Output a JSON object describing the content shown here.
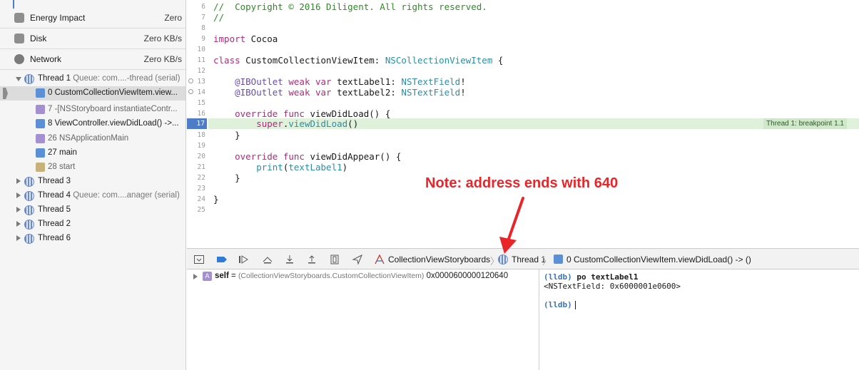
{
  "navigator": {
    "gauges": [
      {
        "label": "Energy Impact",
        "value": "Zero",
        "icon": "energy-icon"
      },
      {
        "label": "Disk",
        "value": "Zero KB/s",
        "icon": "disk-icon"
      },
      {
        "label": "Network",
        "value": "Zero KB/s",
        "icon": "network-icon"
      }
    ],
    "thread1": {
      "name": "Thread 1",
      "queue": "Queue: com....-thread (serial)"
    },
    "frames": [
      {
        "label": "0 CustomCollectionViewItem.view...",
        "kind": "user"
      },
      {
        "label": "7 -[NSStoryboard instantiateContr...",
        "kind": "framework"
      },
      {
        "label": "8 ViewController.viewDidLoad() ->...",
        "kind": "user"
      },
      {
        "label": "26 NSApplicationMain",
        "kind": "framework"
      },
      {
        "label": "27 main",
        "kind": "user"
      },
      {
        "label": "28 start",
        "kind": "system"
      }
    ],
    "threads": [
      {
        "name": "Thread 3",
        "queue": ""
      },
      {
        "name": "Thread 4",
        "queue": "Queue: com....anager (serial)"
      },
      {
        "name": "Thread 5",
        "queue": ""
      },
      {
        "name": "Thread 2",
        "queue": ""
      },
      {
        "name": "Thread 6",
        "queue": ""
      }
    ]
  },
  "editor": {
    "line_numbers": [
      "6",
      "7",
      "8",
      "9",
      "10",
      "11",
      "12",
      "13",
      "14",
      "15",
      "16",
      "17",
      "18",
      "19",
      "20",
      "21",
      "22",
      "23",
      "24",
      "25"
    ],
    "current_line": "17",
    "lines": {
      "l6": "//  Copyright © 2016 Diligent. All rights reserved.",
      "l7": "//",
      "l9_kw": "import",
      "l9_rest": " Cocoa",
      "l11_kw": "class",
      "l11_name": " CustomCollectionViewItem: ",
      "l11_type": "NSCollectionViewItem",
      "l11_end": " {",
      "l13_attr": "    @IBOutlet",
      "l13_kw": " weak var",
      "l13_name": " textLabel1: ",
      "l13_type": "NSTextField",
      "l13_end": "!",
      "l14_attr": "    @IBOutlet",
      "l14_kw": " weak var",
      "l14_name": " textLabel2: ",
      "l14_type": "NSTextField",
      "l14_end": "!",
      "l16_kw": "    override func",
      "l16_rest": " viewDidLoad() {",
      "l17_kw": "        super",
      "l17_dot": ".",
      "l17_call": "viewDidLoad",
      "l17_end": "()",
      "l18": "    }",
      "l20_kw": "    override func",
      "l20_rest": " viewDidAppear() {",
      "l21_call": "        print",
      "l21_paren": "(",
      "l21_arg": "textLabel1",
      "l21_end": ")",
      "l22": "    }",
      "l24": "}"
    },
    "breakpoint_label": "Thread 1: breakpoint 1.1"
  },
  "annotation": {
    "text": "Note: address ends with 640"
  },
  "debugbar": {
    "crumbs": [
      "CollectionViewStoryboards",
      "Thread 1",
      "0 CustomCollectionViewItem.viewDidLoad() -> ()"
    ]
  },
  "variables": {
    "name": "self",
    "equals": " = ",
    "type": "(CollectionViewStoryboards.CustomCollectionViewItem)",
    "value": " 0x0000600000120640"
  },
  "console": {
    "prompt": "(lldb)",
    "command": " po textLabel1",
    "output": "<NSTextField: 0x6000001e0600>"
  },
  "colors": {
    "annotation": "#e8262a",
    "current_line": "#4d7cc9",
    "keyword": "#b3287e",
    "type": "#2a8fa6",
    "comment": "#2e8a26"
  }
}
